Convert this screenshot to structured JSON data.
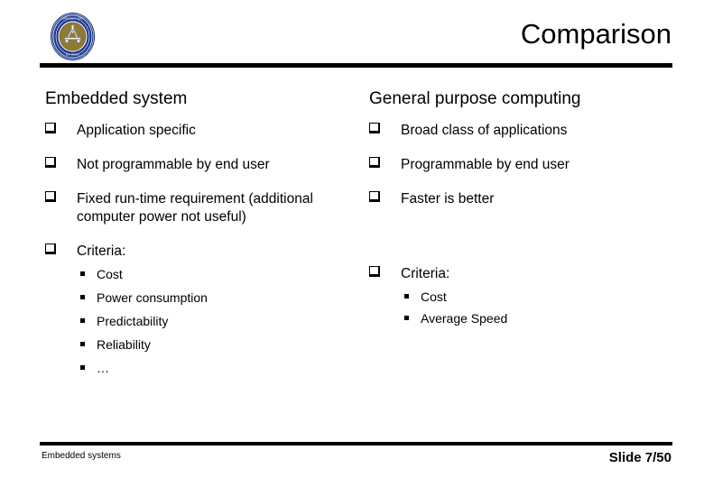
{
  "slide": {
    "title": "Comparison",
    "logo_icon": "university-seal-logo",
    "colors": {
      "rule": "#000000",
      "text": "#000000",
      "background": "#ffffff",
      "logo_ring": "#1f3a93",
      "logo_disc": "#8a7432",
      "logo_emblem": "#e8eef7"
    }
  },
  "columns": [
    {
      "heading": "Embedded system",
      "items": [
        {
          "text": "Application specific",
          "sub": []
        },
        {
          "text": "Not programmable by end user",
          "sub": []
        },
        {
          "text": "Fixed run-time requirement (additional computer power not useful)",
          "sub": []
        },
        {
          "text": "Criteria:",
          "sub": [
            "Cost",
            "Power consumption",
            "Predictability",
            "Reliability",
            "…"
          ]
        }
      ]
    },
    {
      "heading": "General purpose computing",
      "items": [
        {
          "text": "Broad class of applications",
          "sub": []
        },
        {
          "text": "Programmable by end user",
          "sub": []
        },
        {
          "text": "Faster is better",
          "sub": []
        },
        {
          "text": "Criteria:",
          "sub": [
            "Cost",
            "Average Speed"
          ]
        }
      ]
    }
  ],
  "footer": {
    "left": "Embedded systems",
    "right": "Slide 7/50"
  }
}
